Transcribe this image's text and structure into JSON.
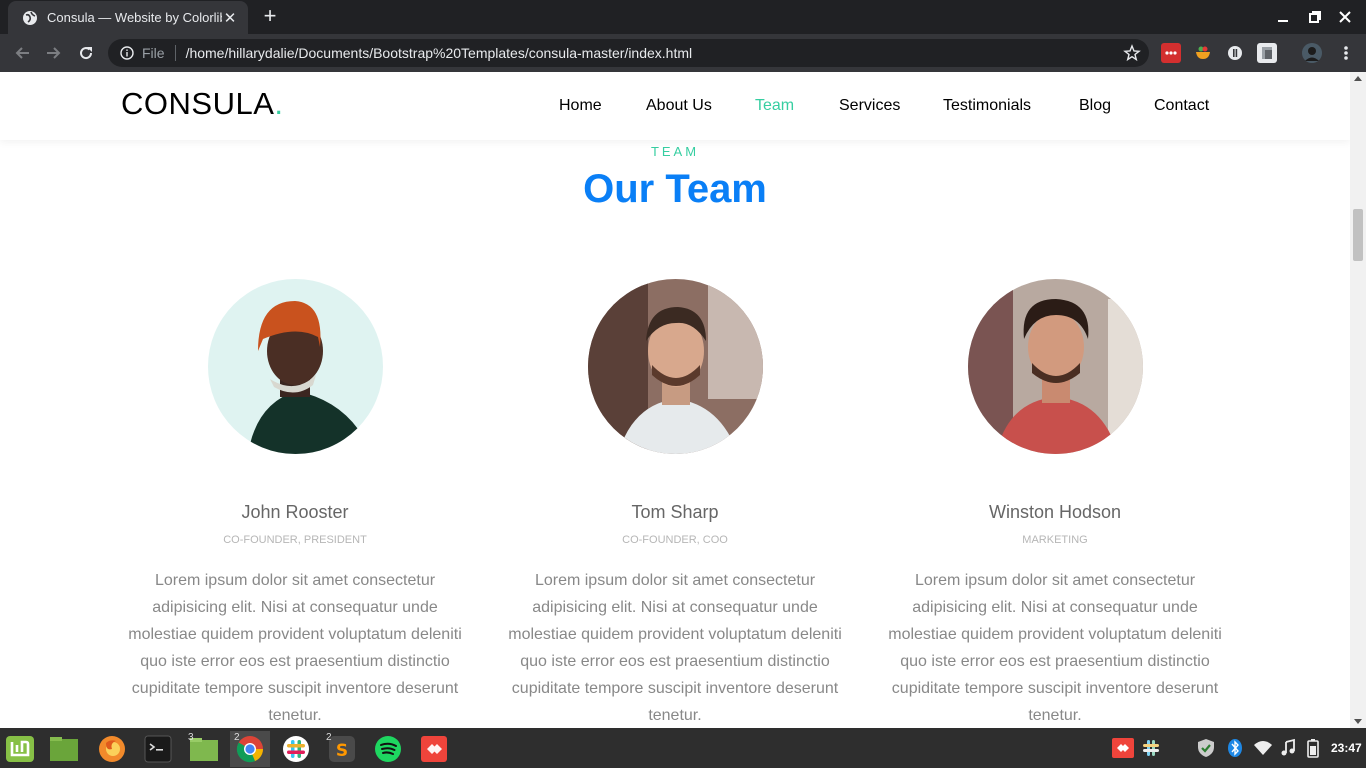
{
  "browser": {
    "tab_title": "Consula — Website by Colorlib",
    "url_scheme_label": "File",
    "url": "/home/hillarydalie/Documents/Bootstrap%20Templates/consula-master/index.html"
  },
  "site": {
    "logo": "CONSULA",
    "logo_dot": ".",
    "nav": [
      "Home",
      "About Us",
      "Team",
      "Services",
      "Testimonials",
      "Blog",
      "Contact"
    ],
    "active_nav": "Team",
    "accent_color": "#36cea1",
    "heading_color": "#0a7ff6"
  },
  "team_section": {
    "eyebrow": "TEAM",
    "heading": "Our Team",
    "members": [
      {
        "name": "John Rooster",
        "role": "CO-FOUNDER, PRESIDENT",
        "bio": "Lorem ipsum dolor sit amet consectetur adipisicing elit. Nisi at consequatur unde molestiae quidem provident voluptatum deleniti quo iste error eos est praesentium distinctio cupiditate tempore suscipit inventore deserunt tenetur."
      },
      {
        "name": "Tom Sharp",
        "role": "CO-FOUNDER, COO",
        "bio": "Lorem ipsum dolor sit amet consectetur adipisicing elit. Nisi at consequatur unde molestiae quidem provident voluptatum deleniti quo iste error eos est praesentium distinctio cupiditate tempore suscipit inventore deserunt tenetur."
      },
      {
        "name": "Winston Hodson",
        "role": "MARKETING",
        "bio": "Lorem ipsum dolor sit amet consectetur adipisicing elit. Nisi at consequatur unde molestiae quidem provident voluptatum deleniti quo iste error eos est praesentium distinctio cupiditate tempore suscipit inventore deserunt tenetur."
      }
    ]
  },
  "taskbar": {
    "apps": [
      {
        "icon": "mint-menu-icon",
        "badge": ""
      },
      {
        "icon": "file-manager-icon",
        "badge": ""
      },
      {
        "icon": "firefox-icon",
        "badge": ""
      },
      {
        "icon": "terminal-icon",
        "badge": ""
      },
      {
        "icon": "folder-icon",
        "badge": "3"
      },
      {
        "icon": "chrome-icon",
        "badge": "2"
      },
      {
        "icon": "slack-icon",
        "badge": ""
      },
      {
        "icon": "sublime-text-icon",
        "badge": "2"
      },
      {
        "icon": "spotify-icon",
        "badge": ""
      },
      {
        "icon": "anydesk-icon",
        "badge": ""
      }
    ],
    "clock": "23:47"
  }
}
